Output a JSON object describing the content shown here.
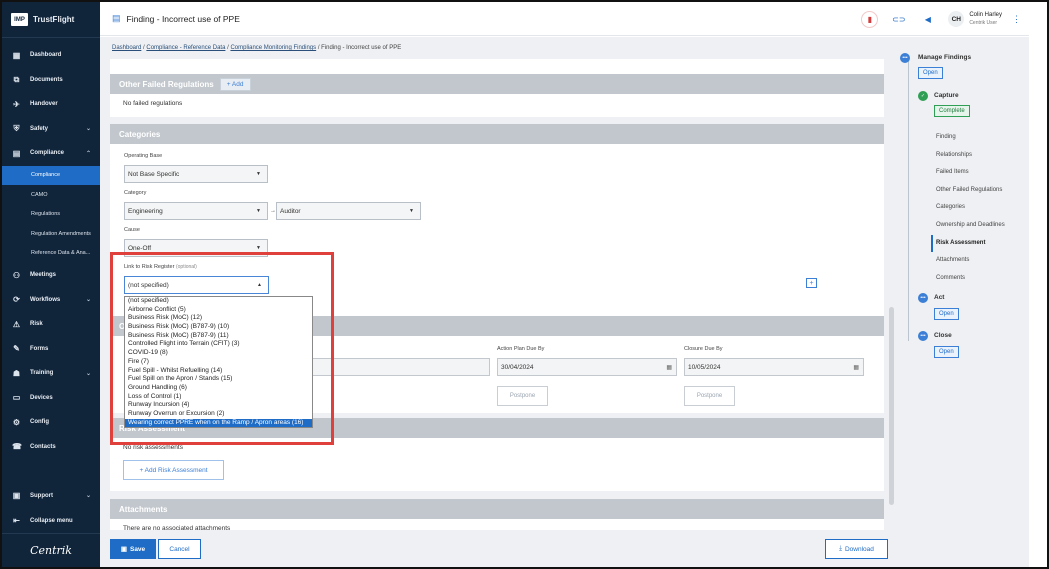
{
  "app": {
    "brand": "TrustFlight",
    "logo_text": "IMP",
    "footer_brand": "Centrik"
  },
  "sidebar": {
    "items": [
      {
        "label": "Dashboard",
        "icon": "dashboard-icon",
        "glyph": "▦"
      },
      {
        "label": "Documents",
        "icon": "documents-icon",
        "glyph": "⧉"
      },
      {
        "label": "Handover",
        "icon": "handover-icon",
        "glyph": "✈"
      },
      {
        "label": "Safety",
        "icon": "safety-icon",
        "glyph": "⛨",
        "chevron": "⌄"
      },
      {
        "label": "Compliance",
        "icon": "compliance-icon",
        "glyph": "▤",
        "chevron": "⌃"
      }
    ],
    "sub_items": [
      "Compliance",
      "CAMO",
      "Regulations",
      "Regulation Amendments",
      "Reference Data & Ana..."
    ],
    "items2": [
      {
        "label": "Meetings",
        "icon": "meetings-icon",
        "glyph": "⚇"
      },
      {
        "label": "Workflows",
        "icon": "workflows-icon",
        "glyph": "⟳",
        "chevron": "⌄"
      },
      {
        "label": "Risk",
        "icon": "risk-icon",
        "glyph": "⚠"
      },
      {
        "label": "Forms",
        "icon": "forms-icon",
        "glyph": "✎"
      },
      {
        "label": "Training",
        "icon": "training-icon",
        "glyph": "☗",
        "chevron": "⌄"
      },
      {
        "label": "Devices",
        "icon": "devices-icon",
        "glyph": "▭"
      },
      {
        "label": "Config",
        "icon": "config-icon",
        "glyph": "⚙"
      },
      {
        "label": "Contacts",
        "icon": "contacts-icon",
        "glyph": "☎"
      }
    ],
    "support": "Support",
    "collapse": "Collapse menu"
  },
  "header": {
    "title": "Finding - Incorrect use of PPE",
    "avatar": "CH",
    "user_name": "Colin Harley",
    "user_role": "Centrik User"
  },
  "breadcrumb": {
    "b1": "Dashboard",
    "b2": "Compliance - Reference Data",
    "b3": "Compliance Monitoring Findings",
    "current": "Finding - Incorrect use of PPE",
    "sep": "/"
  },
  "other_failed": {
    "title": "Other Failed Regulations",
    "add": "+ Add",
    "empty": "No failed regulations"
  },
  "categories": {
    "title": "Categories",
    "operating_base_label": "Operating Base",
    "operating_base_value": "Not Base Specific",
    "category_label": "Category",
    "category_value": "Engineering",
    "category_arrow": "→",
    "subcategory_value": "Auditor",
    "cause_label": "Cause",
    "cause_value": "One-Off",
    "link_label": "Link to Risk Register",
    "link_optional": "(optional)",
    "link_value": "(not specified)",
    "plus": "+"
  },
  "dropdown_options": [
    "(not specified)",
    "Airborne Conflict (5)",
    "Business Risk (MoC) (12)",
    "Business Risk (MoC) (B787-9) (10)",
    "Business Risk (MoC) (B787-9) (11)",
    "Controlled Flight into Terrain (CFIT) (3)",
    "COVID-19 (8)",
    "Fire (7)",
    "Fuel Spill - Whilst Refuelling (14)",
    "Fuel Spill on the Apron / Stands (15)",
    "Ground Handling (6)",
    "Loss of Control (1)",
    "Runway Incursion (4)",
    "Runway Overrun or Excursion (2)",
    "Wearing correct PPRE when on the Ramp / Apron areas (16)"
  ],
  "ownership": {
    "title_partial": "O",
    "label_partial": "O",
    "action_plan_label": "Action Plan Due By",
    "action_plan_value": "30/04/2024",
    "closure_label": "Closure Due By",
    "closure_value": "10/05/2024",
    "postpone": "Postpone"
  },
  "risk": {
    "title": "Risk Assessment",
    "empty": "No risk assessments",
    "add": "+ Add Risk Assessment"
  },
  "attachments": {
    "title": "Attachments",
    "empty": "There are no associated attachments"
  },
  "footer": {
    "save": "Save",
    "cancel": "Cancel",
    "download": "Download"
  },
  "right_panel": {
    "manage": "Manage Findings",
    "manage_status": "Open",
    "capture": "Capture",
    "capture_status": "Complete",
    "substeps": [
      "Finding",
      "Relationships",
      "Failed Items",
      "Other Failed Regulations",
      "Categories",
      "Ownership and Deadlines",
      "Risk Assessment",
      "Attachments",
      "Comments"
    ],
    "act": "Act",
    "act_status": "Open",
    "close": "Close",
    "close_status": "Open"
  },
  "colors": {
    "accent": "#1f6cc7",
    "sidebar": "#10243a",
    "highlight_box": "#e0403b",
    "complete": "#2e9f54"
  }
}
